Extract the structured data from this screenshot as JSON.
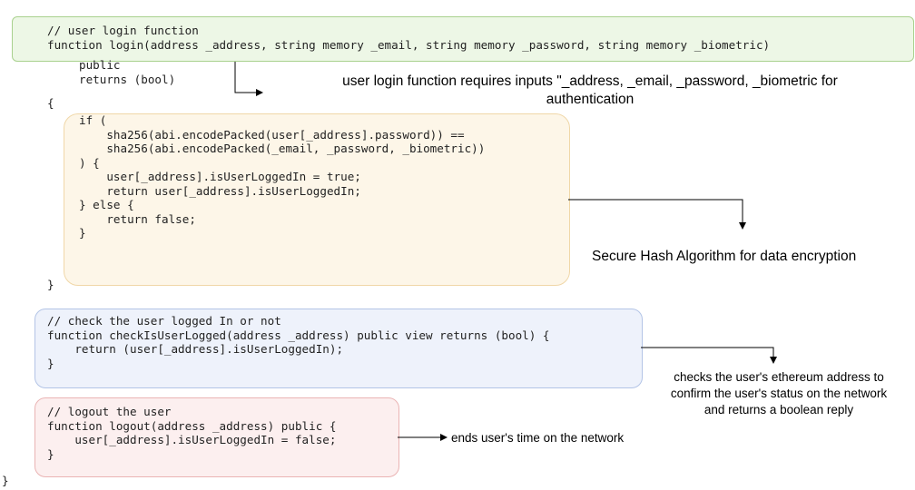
{
  "code": {
    "login_header": [
      "// user login function",
      "function login(address _address, string memory _email, string memory _password, string memory _biometric)"
    ],
    "login_signature": [
      "public",
      "returns (bool)"
    ],
    "login_open_brace": "{",
    "login_body": [
      "if (",
      "    sha256(abi.encodePacked(user[_address].password)) ==",
      "    sha256(abi.encodePacked(_email, _password, _biometric))",
      ") {",
      "    user[_address].isUserLoggedIn = true;",
      "    return user[_address].isUserLoggedIn;",
      "} else {",
      "    return false;",
      "}"
    ],
    "login_close_brace": "}",
    "check_block": [
      "// check the user logged In or not",
      "function checkIsUserLogged(address _address) public view returns (bool) {",
      "    return (user[_address].isUserLoggedIn);",
      "}"
    ],
    "logout_block": [
      "// logout the user",
      "function logout(address _address) public {",
      "    user[_address].isUserLoggedIn = false;",
      "}"
    ],
    "final_brace": "}"
  },
  "annotations": {
    "login_inputs": [
      "user login function requires inputs \"_address, _email, _password, _biometric for",
      "authentication"
    ],
    "sha": "Secure Hash Algorithm for data encryption",
    "check": [
      "checks the user's ethereum address to",
      "confirm the user's status on the network",
      "and returns a boolean reply"
    ],
    "logout": "ends user's time on the network"
  },
  "colors": {
    "login_box_fill": "#edf7e6",
    "login_box_border": "#a9d18e",
    "body_box_fill": "#fdf6e8",
    "body_box_border": "#f0d7a8",
    "check_box_fill": "#eef2fb",
    "check_box_border": "#b3c4e6",
    "logout_box_fill": "#fcefef",
    "logout_box_border": "#eab4b4",
    "arrow": "#000000"
  }
}
